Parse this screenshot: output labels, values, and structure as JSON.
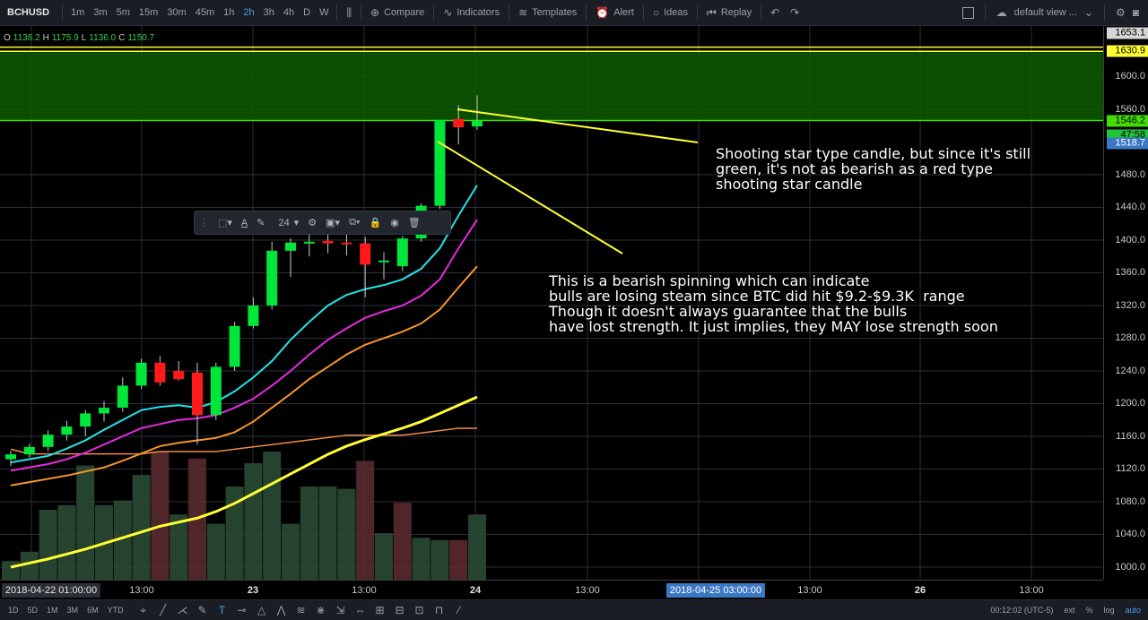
{
  "toolbar": {
    "symbol": "BCHUSD",
    "intervals": [
      "1m",
      "3m",
      "5m",
      "15m",
      "30m",
      "45m",
      "1h",
      "2h",
      "3h",
      "4h",
      "D",
      "W"
    ],
    "active_interval": "2h",
    "compare": "Compare",
    "indicators": "Indicators",
    "templates": "Templates",
    "alert": "Alert",
    "ideas": "Ideas",
    "replay": "Replay",
    "layout": "default view ..."
  },
  "legend": {
    "o_label": "O",
    "o": "1138.2",
    "h_label": "H",
    "h": "1175.9",
    "l_label": "L",
    "l": "1136.0",
    "c_label": "C",
    "c": "1150.7"
  },
  "draw_toolbar": {
    "font_size": "24"
  },
  "price_axis": {
    "labels": [
      "1600.0",
      "1560.0",
      "1480.0",
      "1440.0",
      "1400.0",
      "1360.0",
      "1320.0",
      "1280.0",
      "1240.0",
      "1200.0",
      "1160.0",
      "1120.0",
      "1080.0",
      "1040.0",
      "1000.0"
    ],
    "label_values": [
      1600,
      1560,
      1480,
      1440,
      1400,
      1360,
      1320,
      1280,
      1240,
      1200,
      1160,
      1120,
      1080,
      1040,
      1000
    ],
    "top_label": "1653.1",
    "marker_yellow": "1630.9",
    "marker_green": "1546.2",
    "countdown": "47:58",
    "marker_blue": "1518.7"
  },
  "time_axis": {
    "labels": [
      {
        "text": "13:00",
        "bold": false
      },
      {
        "text": "23",
        "bold": true
      },
      {
        "text": "13:00",
        "bold": false
      },
      {
        "text": "24",
        "bold": true
      },
      {
        "text": "13:00",
        "bold": false
      },
      {
        "text": "13:00",
        "bold": false
      },
      {
        "text": "26",
        "bold": true
      },
      {
        "text": "13:00",
        "bold": false
      }
    ],
    "left_box": "2018-04-22 01:00:00",
    "center_box": "2018-04-25 03:00:00"
  },
  "bottom_bar": {
    "ranges": [
      "1D",
      "5D",
      "1M",
      "3M",
      "6M",
      "YTD"
    ],
    "time": "00:12:02 (UTC-5)",
    "ext": "ext",
    "pct": "%",
    "log": "log",
    "auto": "auto"
  },
  "annotations": {
    "note1": "Shooting star type candle, but since it's still\ngreen, it's not as bearish as a red type\nshooting star candle",
    "note2": "This is a bearish spinning which can indicate\nbulls are losing steam since BTC did hit $9.2-$9.3K  range\nThough it doesn't always guarantee that the bulls\nhave lost strength. It just implies, they MAY lose strength soon"
  },
  "colors": {
    "up": "#00e639",
    "down": "#ff1a1a",
    "zone": "#0d5c00",
    "yellow": "#ffff33",
    "cyan": "#22e3e8",
    "magenta": "#e82ae0",
    "orange": "#f5962a",
    "green_line": "#44dd00"
  },
  "chart_data": {
    "type": "candlestick",
    "candles": [
      {
        "o": 1132,
        "h": 1142,
        "l": 1124,
        "c": 1138
      },
      {
        "o": 1138,
        "h": 1151,
        "l": 1134,
        "c": 1147
      },
      {
        "o": 1147,
        "h": 1167,
        "l": 1142,
        "c": 1162
      },
      {
        "o": 1162,
        "h": 1179,
        "l": 1155,
        "c": 1172
      },
      {
        "o": 1172,
        "h": 1192,
        "l": 1160,
        "c": 1188
      },
      {
        "o": 1188,
        "h": 1203,
        "l": 1178,
        "c": 1195
      },
      {
        "o": 1195,
        "h": 1232,
        "l": 1190,
        "c": 1222
      },
      {
        "o": 1222,
        "h": 1255,
        "l": 1218,
        "c": 1250
      },
      {
        "o": 1250,
        "h": 1258,
        "l": 1222,
        "c": 1226
      },
      {
        "o": 1240,
        "h": 1252,
        "l": 1228,
        "c": 1230
      },
      {
        "o": 1238,
        "h": 1250,
        "l": 1150,
        "c": 1186
      },
      {
        "o": 1186,
        "h": 1250,
        "l": 1180,
        "c": 1245
      },
      {
        "o": 1245,
        "h": 1300,
        "l": 1240,
        "c": 1295
      },
      {
        "o": 1295,
        "h": 1330,
        "l": 1292,
        "c": 1320
      },
      {
        "o": 1320,
        "h": 1398,
        "l": 1315,
        "c": 1387
      },
      {
        "o": 1387,
        "h": 1402,
        "l": 1355,
        "c": 1397
      },
      {
        "o": 1397,
        "h": 1408,
        "l": 1380,
        "c": 1398
      },
      {
        "o": 1399,
        "h": 1422,
        "l": 1384,
        "c": 1396
      },
      {
        "o": 1397,
        "h": 1415,
        "l": 1381,
        "c": 1396
      },
      {
        "o": 1396,
        "h": 1404,
        "l": 1330,
        "c": 1370
      },
      {
        "o": 1373,
        "h": 1385,
        "l": 1352,
        "c": 1375
      },
      {
        "o": 1368,
        "h": 1405,
        "l": 1362,
        "c": 1402
      },
      {
        "o": 1402,
        "h": 1445,
        "l": 1398,
        "c": 1442
      },
      {
        "o": 1442,
        "h": 1547,
        "l": 1438,
        "c": 1547
      },
      {
        "o": 1548,
        "h": 1565,
        "l": 1517,
        "c": 1538
      },
      {
        "o": 1539,
        "h": 1577,
        "l": 1535,
        "c": 1546
      }
    ],
    "volume": [
      8,
      12,
      30,
      32,
      49,
      32,
      34,
      45,
      55,
      28,
      52,
      24,
      40,
      50,
      55,
      24,
      40,
      40,
      39,
      51,
      20,
      33,
      18,
      17,
      17,
      28
    ],
    "volume_up": [
      true,
      true,
      true,
      true,
      true,
      true,
      true,
      true,
      false,
      true,
      false,
      true,
      true,
      true,
      true,
      true,
      true,
      true,
      true,
      false,
      true,
      false,
      true,
      true,
      false,
      true
    ],
    "ma_cyan": [
      1128,
      1132,
      1136,
      1145,
      1155,
      1168,
      1180,
      1192,
      1196,
      1198,
      1195,
      1202,
      1215,
      1232,
      1252,
      1278,
      1300,
      1320,
      1333,
      1340,
      1345,
      1352,
      1365,
      1390,
      1430,
      1467
    ],
    "ma_magenta": [
      1118,
      1122,
      1126,
      1132,
      1140,
      1150,
      1160,
      1170,
      1175,
      1180,
      1182,
      1186,
      1195,
      1206,
      1222,
      1240,
      1260,
      1278,
      1292,
      1305,
      1313,
      1320,
      1332,
      1352,
      1390,
      1425
    ],
    "ma_orange": [
      1100,
      1104,
      1108,
      1112,
      1117,
      1122,
      1130,
      1139,
      1148,
      1152,
      1155,
      1158,
      1165,
      1178,
      1195,
      1212,
      1230,
      1245,
      1260,
      1272,
      1280,
      1288,
      1298,
      1315,
      1342,
      1368
    ],
    "ma_yellow": [
      1000,
      1005,
      1010,
      1016,
      1022,
      1029,
      1036,
      1043,
      1050,
      1055,
      1060,
      1068,
      1078,
      1090,
      1102,
      1114,
      1126,
      1138,
      1148,
      1156,
      1163,
      1170,
      1178,
      1188,
      1198,
      1208
    ],
    "volume_ma": [
      56,
      54,
      54,
      54,
      54,
      54,
      54,
      54,
      55,
      55,
      55,
      55,
      56,
      57,
      58,
      59,
      60,
      61,
      62,
      62,
      62,
      62,
      63,
      64,
      65,
      65
    ],
    "zone": [
      1546,
      1630
    ],
    "horizontal_lines": [
      1546.2,
      1630.9,
      1636
    ],
    "ylim": [
      1000,
      1653
    ],
    "grid": true
  }
}
